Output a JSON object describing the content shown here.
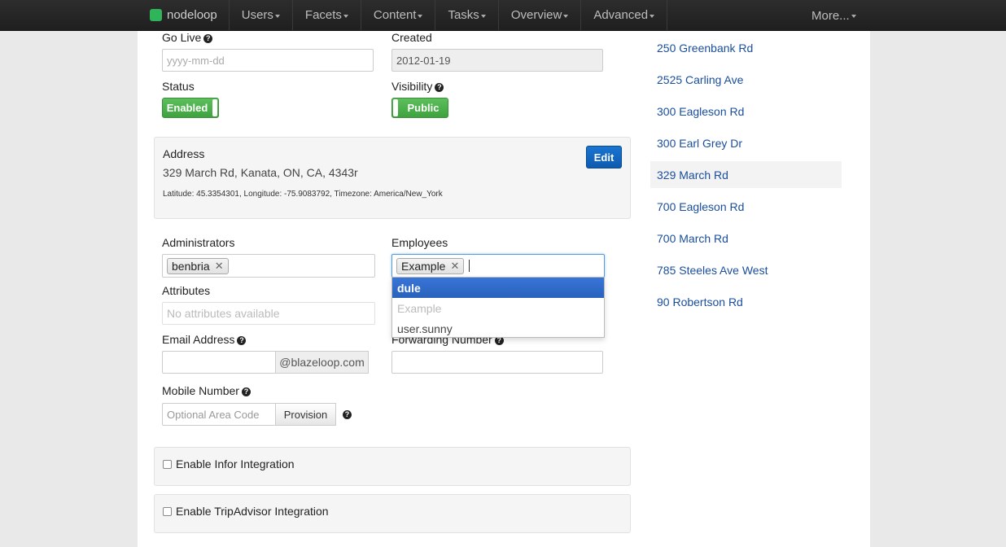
{
  "nav": {
    "brand": "nodeloop",
    "items": [
      "Users",
      "Facets",
      "Content",
      "Tasks",
      "Overview",
      "Advanced"
    ],
    "more": "More..."
  },
  "form": {
    "go_live": {
      "label": "Go Live",
      "placeholder": "yyyy-mm-dd"
    },
    "created": {
      "label": "Created",
      "value": "2012-01-19"
    },
    "status": {
      "label": "Status",
      "toggle": "Enabled"
    },
    "visibility": {
      "label": "Visibility",
      "toggle": "Public"
    },
    "address": {
      "label": "Address",
      "edit": "Edit",
      "line": "329 March Rd, Kanata, ON, CA, 4343r",
      "meta": "Latitude: 45.3354301, Longitude: -75.9083792, Timezone: America/New_York"
    },
    "administrators": {
      "label": "Administrators",
      "tags": [
        "benbria"
      ]
    },
    "employees": {
      "label": "Employees",
      "tags": [
        "Example"
      ],
      "options": [
        {
          "text": "dule",
          "state": "active"
        },
        {
          "text": "Example",
          "state": "disabled"
        },
        {
          "text": "user.sunny",
          "state": "normal"
        }
      ]
    },
    "attributes": {
      "label": "Attributes",
      "placeholder": "No attributes available"
    },
    "email": {
      "label": "Email Address",
      "suffix": "@blazeloop.com"
    },
    "forwarding": {
      "label": "Forwarding Number"
    },
    "mobile": {
      "label": "Mobile Number",
      "placeholder": "Optional Area Code",
      "button": "Provision"
    },
    "integrations": [
      "Enable Infor Integration",
      "Enable TripAdvisor Integration"
    ]
  },
  "sidebar": {
    "locations": [
      "250 Greenbank Rd",
      "2525 Carling Ave",
      "300 Eagleson Rd",
      "300 Earl Grey Dr",
      "329 March Rd",
      "700 Eagleson Rd",
      "700 March Rd",
      "785 Steeles Ave West",
      "90 Robertson Rd"
    ],
    "active_location": "329 March Rd"
  }
}
